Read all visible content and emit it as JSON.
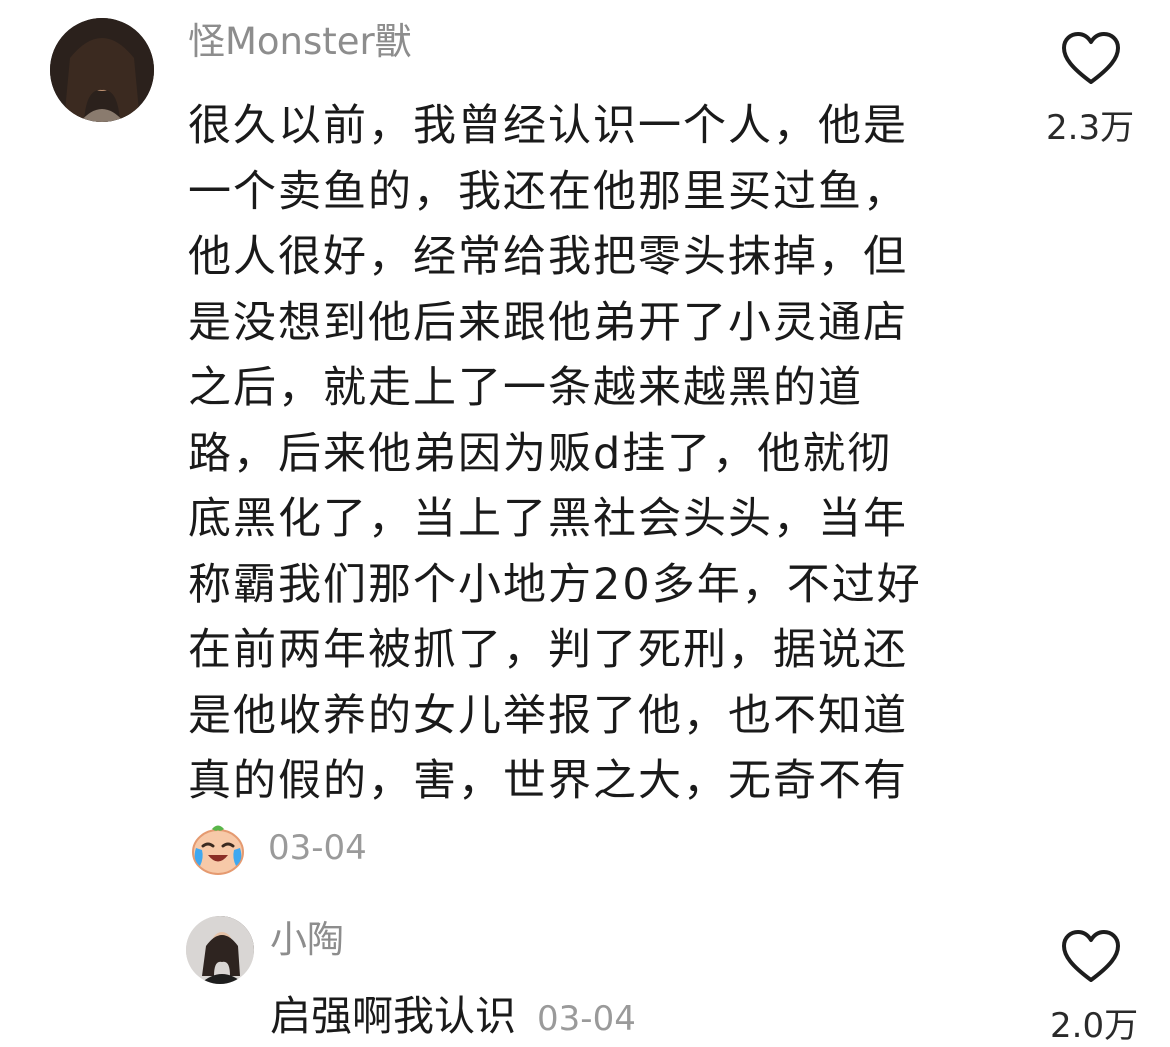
{
  "comment": {
    "username": "怪Monster獸",
    "text_lines": [
      "很久以前，我曾经认识一个人，他是",
      "一个卖鱼的，我还在他那里买过鱼，",
      "他人很好，经常给我把零头抹掉，但",
      "是没想到他后来跟他弟开了小灵通店",
      "之后，就走上了一条越来越黑的道",
      "路，后来他弟因为贩d挂了，他就彻",
      "底黑化了，当上了黑社会头头，当年",
      "称霸我们那个小地方20多年，不过好",
      "在前两年被抓了，判了死刑，据说还",
      "是他收养的女儿举报了他，也不知道",
      "真的假的，害，世界之大，无奇不有"
    ],
    "emoji_icon": "crying-laughing-face-icon",
    "date": "03-04",
    "like_icon": "heart-outline-icon",
    "like_count": "2.3万"
  },
  "reply": {
    "username": "小陶",
    "text": "启强啊我认识",
    "date": "03-04",
    "like_icon": "heart-outline-icon",
    "like_count": "2.0万"
  }
}
